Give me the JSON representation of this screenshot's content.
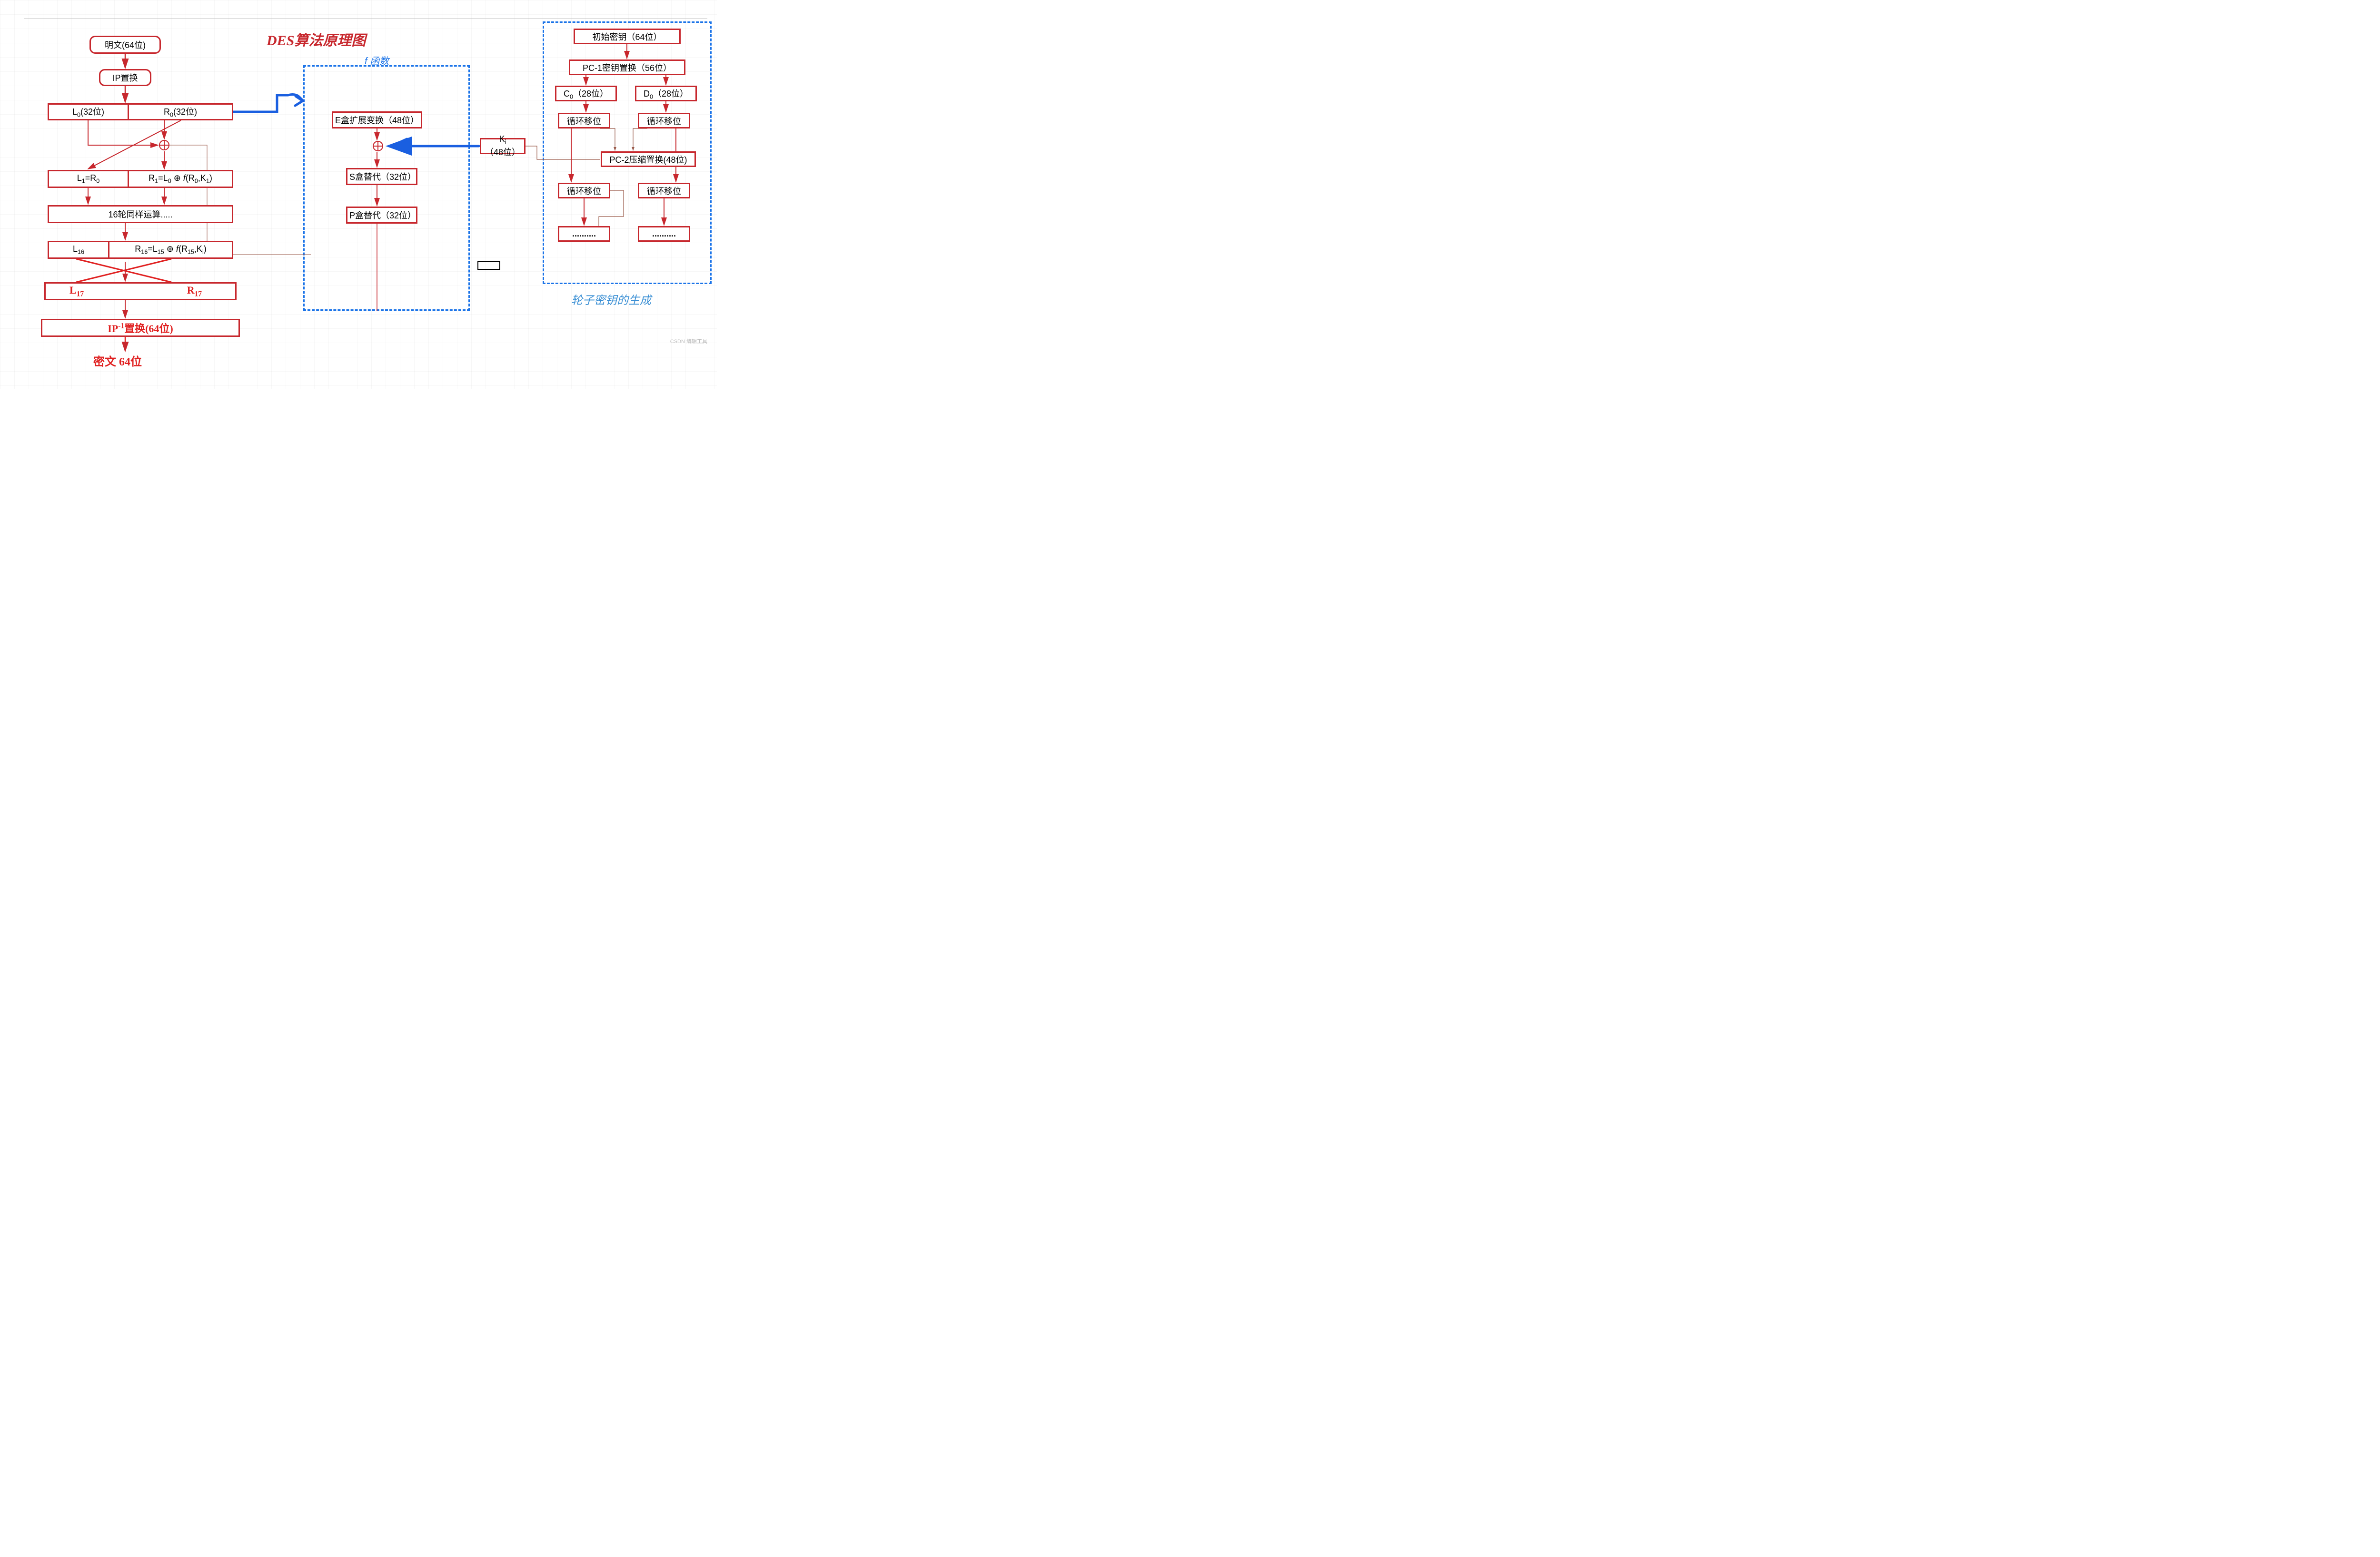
{
  "title": "DES算法原理图",
  "f_label": "f 函数",
  "key_title": "轮子密钥的生成",
  "watermark": "CSDN 编辑工具",
  "left": {
    "plaintext": "明文(64位)",
    "ip": "IP置换",
    "L0": "L0(32位)",
    "R0": "R0(32位)",
    "L1": "L1=R0",
    "R1": "R1=L0 ⊕ f(R0,K1)",
    "rounds": "16轮同样运算.....",
    "L16": "L16",
    "R16": "R16=L15 ⊕ f(R15,Ki)",
    "L17": "L17",
    "R17": "R17",
    "ipinv": "IP⁻¹置换(64位)",
    "cipher": "密文 64位"
  },
  "mid": {
    "ebox": "E盒扩展变换（48位）",
    "sbox": "S盒替代（32位）",
    "pbox": "P盒替代（32位）",
    "ki": "Ki（48位）"
  },
  "right": {
    "initkey": "初始密钥（64位）",
    "pc1": "PC-1密钥置换（56位）",
    "c0": "C0（28位）",
    "d0": "D0（28位）",
    "shift": "循环移位",
    "pc2": "PC-2压缩置换(48位)",
    "dots": ".........."
  }
}
